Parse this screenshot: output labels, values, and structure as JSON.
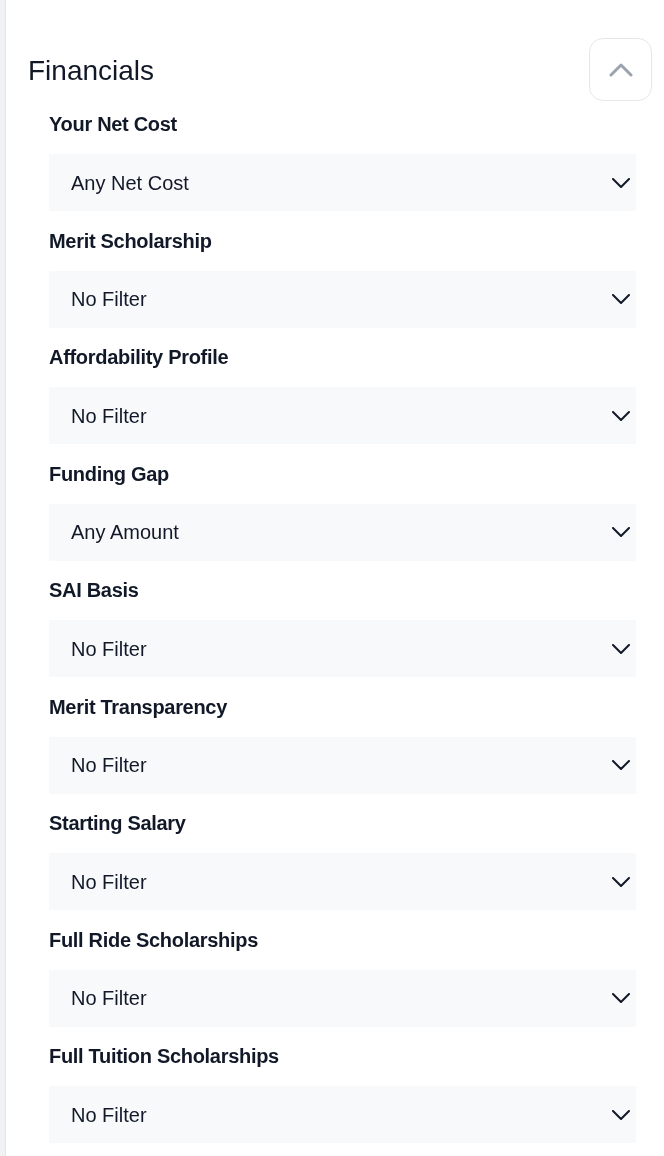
{
  "section": {
    "title": "Financials",
    "expanded": true
  },
  "filters": [
    {
      "label": "Your Net Cost",
      "value": "Any Net Cost"
    },
    {
      "label": "Merit Scholarship",
      "value": "No Filter"
    },
    {
      "label": "Affordability Profile",
      "value": "No Filter"
    },
    {
      "label": "Funding Gap",
      "value": "Any Amount"
    },
    {
      "label": "SAI Basis",
      "value": "No Filter"
    },
    {
      "label": "Merit Transparency",
      "value": "No Filter"
    },
    {
      "label": "Starting Salary",
      "value": "No Filter"
    },
    {
      "label": "Full Ride Scholarships",
      "value": "No Filter"
    },
    {
      "label": "Full Tuition Scholarships",
      "value": "No Filter"
    }
  ]
}
